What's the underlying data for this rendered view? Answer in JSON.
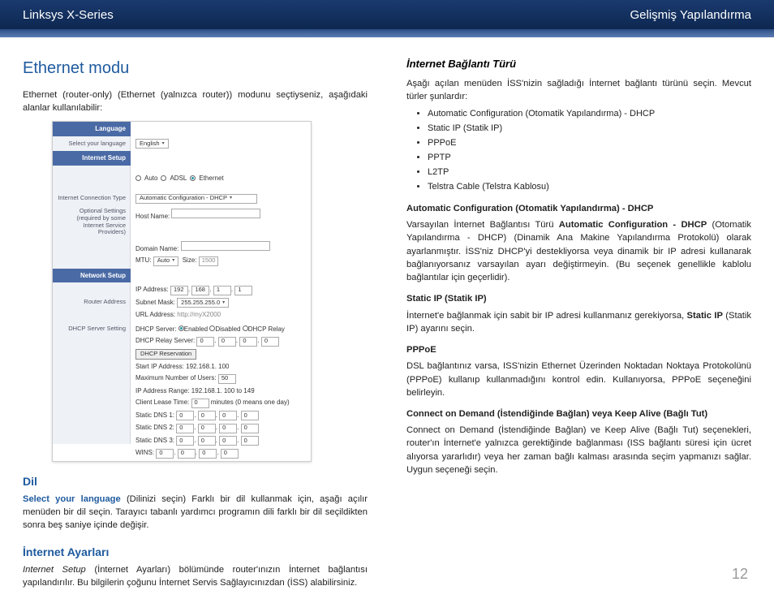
{
  "header": {
    "left": "Linksys X-Series",
    "right": "Gelişmiş Yapılandırma"
  },
  "left": {
    "title": "Ethernet modu",
    "intro": "Ethernet (router-only) (Ethernet (yalnızca router)) modunu seçtiyseniz, aşağıdaki alanlar kullanılabilir:",
    "dil_h": "Dil",
    "dil_lead": "Select your language",
    "dil_body": " (Dilinizi seçin) Farklı bir dil kullanmak için, aşağı açılır menüden bir dil seçin. Tarayıcı tabanlı yardımcı programın dili farklı bir dil seçildikten sonra beş saniye içinde değişir.",
    "net_h": "İnternet Ayarları",
    "net_lead": "Internet Setup",
    "net_body": " (İnternet Ayarları) bölümünde router'ınızın İnternet bağlantısı yapılandırılır. Bu bilgilerin çoğunu İnternet Servis Sağlayıcınızdan (İSS) alabilirsiniz."
  },
  "shot": {
    "lang_h": "Language",
    "sel_lang": "Select your language",
    "english": "English",
    "net_h": "Internet Setup",
    "conn_type": "Internet Connection Type",
    "auto": "Auto",
    "adsl": "ADSL",
    "eth": "Ethernet",
    "autoconf": "Automatic Configuration - DHCP",
    "opt": "Optional Settings\n(required by some Internet Service Providers)",
    "host": "Host Name:",
    "domain": "Domain Name:",
    "mtu": "MTU:",
    "mtuv": "Auto",
    "size": "Size:",
    "sizev": "1500",
    "netsetup": "Network Setup",
    "raddr": "Router Address",
    "ip": "IP Address:",
    "ipa": "192",
    "ipb": "168",
    "ipc": "1",
    "ipd": "1",
    "mask": "Subnet Mask:",
    "maskv": "255.255.255.0",
    "url": "URL Address:",
    "urlv": "http://myX2000",
    "dhcp": "DHCP Server Setting",
    "dhcps": "DHCP Server:",
    "en": "Enabled",
    "dis": "Disabled",
    "relay": "DHCP Relay",
    "relaysrv": "DHCP Relay Server:",
    "res": "DHCP Reservation",
    "sip": "Start IP Address:",
    "sipv": "192.168.1. 100",
    "max": "Maximum Number of Users:",
    "maxv": "50",
    "range": "IP Address Range:",
    "rangev": "192.168.1. 100 to 149",
    "lease": "Client Lease Time:",
    "leasev": "0",
    "leasenote": "minutes (0 means one day)",
    "dns1": "Static DNS 1:",
    "dns2": "Static DNS 2:",
    "dns3": "Static DNS 3:",
    "wins": "WINS:",
    "z": "0"
  },
  "right": {
    "h": "İnternet Bağlantı Türü",
    "intro": "Aşağı açılan menüden İSS'nizin sağladığı İnternet bağlantı türünü seçin. Mevcut türler şunlardır:",
    "bullets": [
      "Automatic Configuration (Otomatik Yapılandırma) - DHCP",
      "Static IP (Statik IP)",
      "PPPoE",
      "PPTP",
      "L2TP",
      "Telstra Cable (Telstra Kablosu)"
    ],
    "dhcp_h": "Automatic Configuration (Otomatik Yapılandırma) - DHCP",
    "dhcp_body1": "Varsayılan İnternet Bağlantısı Türü ",
    "dhcp_bold": "Automatic Configuration - DHCP",
    "dhcp_body2": " (Otomatik Yapılandırma - DHCP) (Dinamik Ana Makine Yapılandırma Protokolü) olarak ayarlanmıştır. İSS'niz DHCP'yi destekliyorsa veya dinamik bir IP adresi kullanarak bağlanıyorsanız varsayılan ayarı değiştirmeyin. (Bu seçenek genellikle kablolu bağlantılar için geçerlidir).",
    "static_h": "Static IP (Statik IP)",
    "static_body1": "İnternet'e bağlanmak için sabit bir IP adresi kullanmanız gerekiyorsa, ",
    "static_bold": "Static IP",
    "static_body2": " (Statik IP) ayarını seçin.",
    "pppoe_h": "PPPoE",
    "pppoe_body": "DSL bağlantınız varsa, ISS'nizin Ethernet Üzerinden Noktadan Noktaya Protokolünü (PPPoE) kullanıp kullanmadığını kontrol edin. Kullanıyorsa, PPPoE seçeneğini belirleyin.",
    "cod_h": "Connect on Demand (İstendiğinde Bağlan) veya Keep Alive (Bağlı Tut)",
    "cod_body": "Connect on Demand (İstendiğinde Bağlan) ve Keep Alive (Bağlı Tut) seçenekleri, router'ın İnternet'e yalnızca gerektiğinde bağlanması (ISS bağlantı süresi için ücret alıyorsa yararlıdır) veya her zaman bağlı kalması arasında seçim yapmanızı sağlar. Uygun seçeneği seçin."
  },
  "page": "12"
}
